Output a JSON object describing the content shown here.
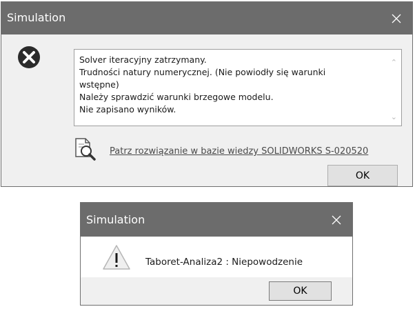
{
  "dialog1": {
    "title": "Simulation",
    "close_glyph": "✕",
    "icon": "error-icon",
    "message_lines": [
      "Solver iteracyjny zatrzymany.",
      "Trudności natury numerycznej. (Nie powiodły się warunki",
      "wstępne)",
      "Należy sprawdzić warunki brzegowe modelu.",
      "Nie zapisano wyników."
    ],
    "scroll_up": "⌃",
    "scroll_down": "⌄",
    "kb_icon": "knowledge-base-search-icon",
    "kb_link": "Patrz rozwiązanie w bazie wiedzy SOLIDWORKS S-020520",
    "ok_label": "OK"
  },
  "dialog2": {
    "title": "Simulation",
    "close_glyph": "✕",
    "icon": "warning-icon",
    "message": "Taboret-Analiza2 : Niepowodzenie",
    "ok_label": "OK"
  },
  "colors": {
    "titlebar": "#6c6c6c",
    "dialog_bg": "#f0f0f0",
    "link": "#4a4a4a"
  }
}
